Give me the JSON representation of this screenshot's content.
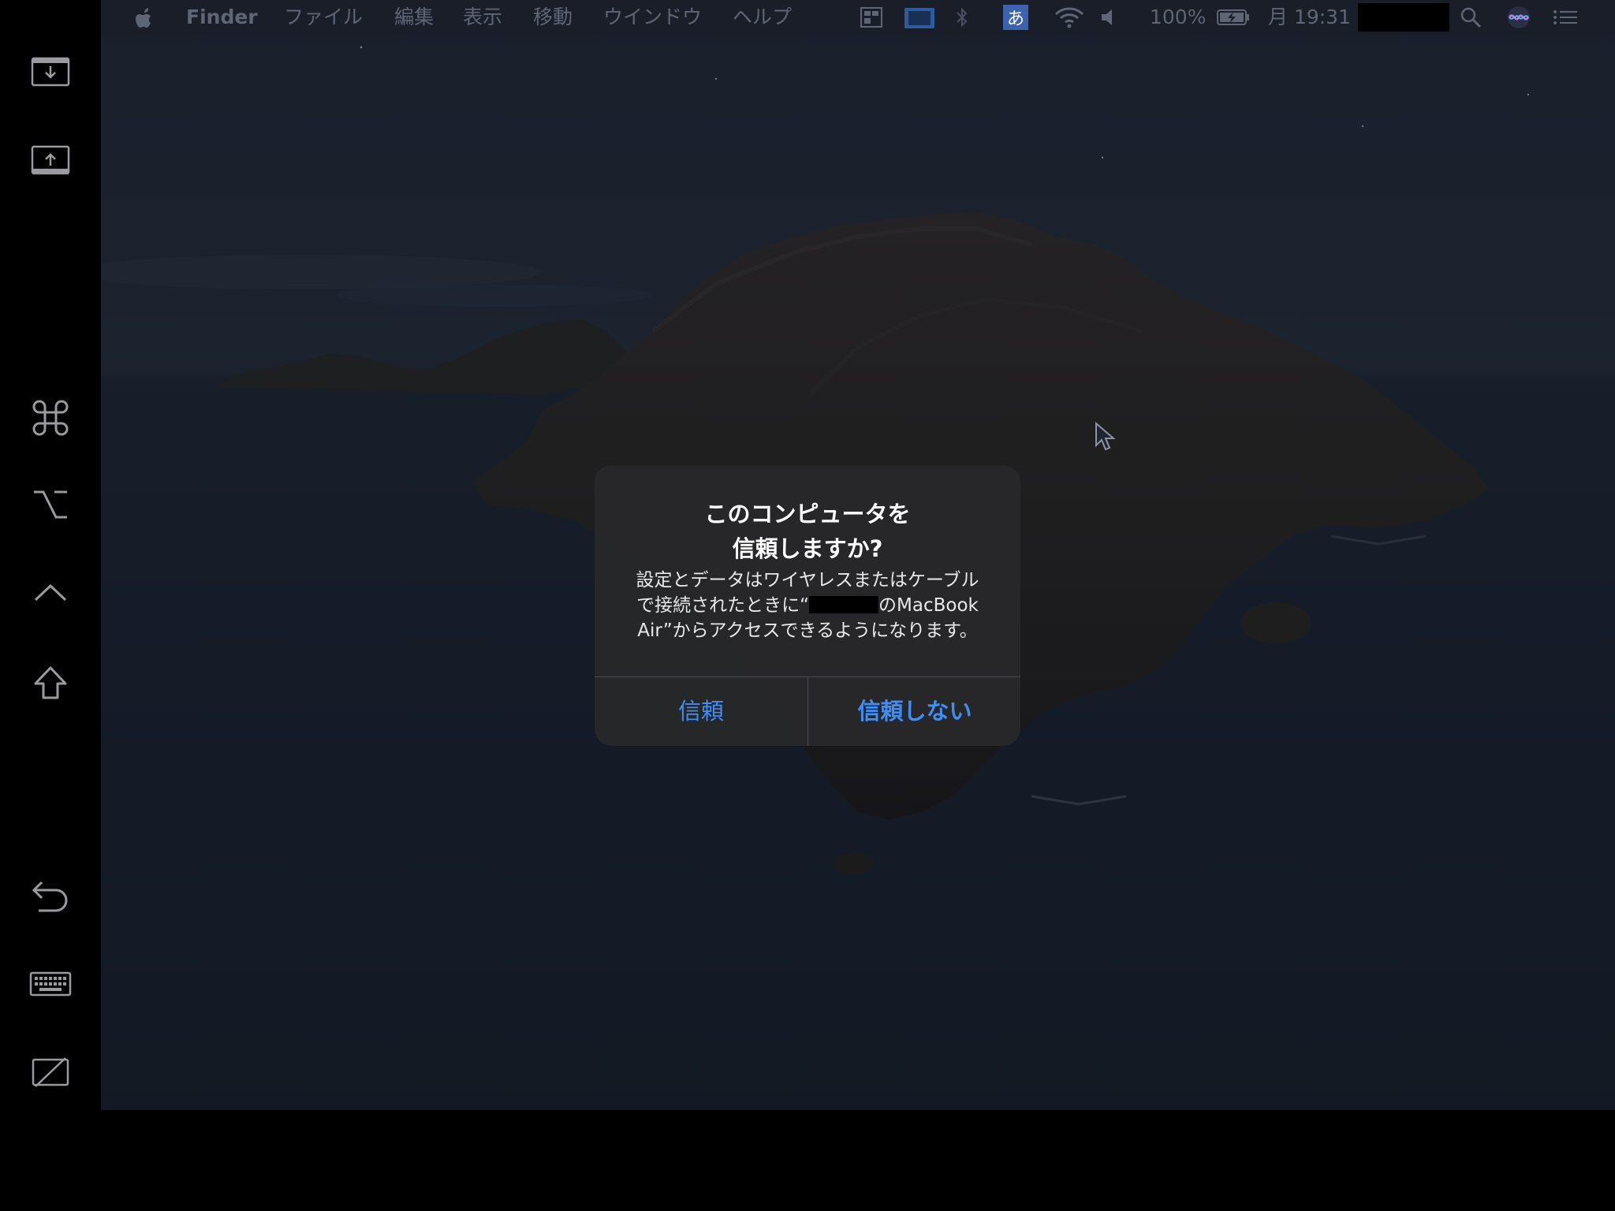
{
  "menubar": {
    "apple": "",
    "app_name": "Finder",
    "menus": [
      "ファイル",
      "編集",
      "表示",
      "移動",
      "ウインドウ",
      "ヘルプ"
    ],
    "input_mode": "あ",
    "battery": "100%",
    "clock": "月 19:31"
  },
  "sidebar": {
    "items": [
      {
        "name": "download-to-screen-icon"
      },
      {
        "name": "upload-from-screen-icon"
      },
      {
        "name": "command-key-icon"
      },
      {
        "name": "option-key-icon"
      },
      {
        "name": "control-key-icon"
      },
      {
        "name": "shift-key-icon"
      },
      {
        "name": "undo-icon"
      },
      {
        "name": "keyboard-icon"
      },
      {
        "name": "disconnect-display-icon"
      }
    ]
  },
  "dialog": {
    "title": "このコンピュータを\n信頼しますか?",
    "body_line1": "設定とデータはワイヤレスまたはケーブル",
    "body_line2_pre": "で接続されたときに“",
    "body_line2_post": "のMacBook",
    "body_line3": "Air”からアクセスできるようになります。",
    "trust_label": "信頼",
    "dont_trust_label": "信頼しない"
  },
  "colors": {
    "accent": "#3f8ef5",
    "dialog_bg": "#28282a",
    "menubar_text": "#5e6575"
  }
}
